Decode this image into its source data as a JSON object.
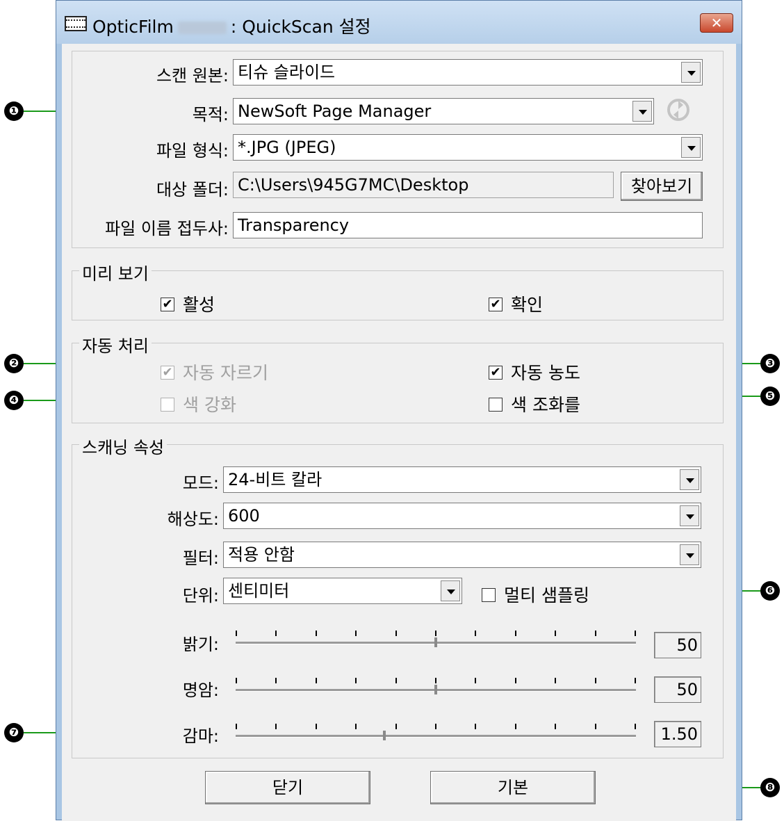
{
  "window": {
    "app_name": "OpticFilm",
    "title_suffix": ": QuickScan 설정",
    "close_label": "✕"
  },
  "source_section": {
    "scan_source_label": "스캔 원본:",
    "scan_source_value": "티슈 슬라이드",
    "destination_label": "목적:",
    "destination_value": "NewSoft Page Manager",
    "file_format_label": "파일 형식:",
    "file_format_value": "*.JPG (JPEG)",
    "target_folder_label": "대상 폴더:",
    "target_folder_value": "C:\\Users\\945G7MC\\Desktop",
    "browse_button": "찾아보기",
    "file_prefix_label": "파일 이름 접두사:",
    "file_prefix_value": "Transparency"
  },
  "preview": {
    "title": "미리 보기",
    "enable_label": "활성",
    "enable_checked": true,
    "confirm_label": "확인",
    "confirm_checked": true
  },
  "auto_process": {
    "title": "자동 처리",
    "auto_crop_label": "자동 자르기",
    "auto_crop_checked": true,
    "auto_crop_disabled": true,
    "auto_density_label": "자동 농도",
    "auto_density_checked": true,
    "color_enhance_label": "색 강화",
    "color_enhance_checked": false,
    "color_enhance_disabled": true,
    "color_harmony_label": "색 조화를",
    "color_harmony_checked": false
  },
  "scan_props": {
    "title": "스캐닝 속성",
    "mode_label": "모드:",
    "mode_value": "24-비트 칼라",
    "resolution_label": "해상도:",
    "resolution_value": "600",
    "filter_label": "필터:",
    "filter_value": "적용 안함",
    "unit_label": "단위:",
    "unit_value": "센티미터",
    "multisample_label": "멀티 샘플링",
    "multisample_checked": false,
    "brightness_label": "밝기:",
    "brightness_value": "50",
    "contrast_label": "명암:",
    "contrast_value": "50",
    "gamma_label": "감마:",
    "gamma_value": "1.50"
  },
  "footer": {
    "close_button": "닫기",
    "default_button": "기본"
  },
  "callouts": [
    "❶",
    "❷",
    "❸",
    "❹",
    "❺",
    "❻",
    "❼",
    "❽"
  ],
  "colors": {
    "callout_arrow": "#0f8f0f",
    "titlebar": "#b6cfe9",
    "close_button": "#c9482d"
  },
  "icons": {
    "title": "film-strip-icon",
    "destination_config": "arrow-cycle-icon",
    "close": "close-icon"
  }
}
